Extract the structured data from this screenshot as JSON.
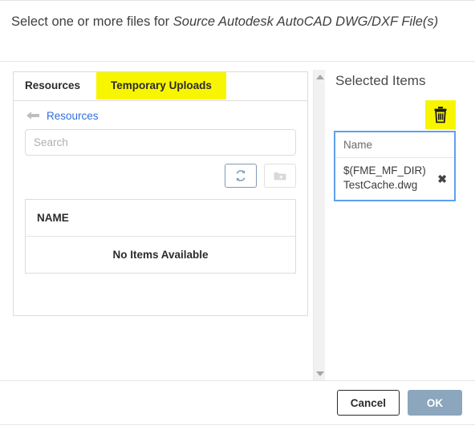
{
  "dialog": {
    "title_plain": "Select one or more files for ",
    "title_emphasis": "Source Autodesk AutoCAD DWG/DXF File(s)"
  },
  "browse_panel": {
    "tabs": [
      {
        "label": "Resources",
        "active": true,
        "highlighted": false
      },
      {
        "label": "Temporary Uploads",
        "active": false,
        "highlighted": true
      }
    ],
    "breadcrumb": {
      "back_icon": "back-arrow-icon",
      "link_label": "Resources"
    },
    "search": {
      "value": "",
      "placeholder": "Search"
    },
    "toolbar": [
      {
        "name": "refresh-button",
        "icon": "refresh-icon",
        "disabled": false
      },
      {
        "name": "new-folder-button",
        "icon": "new-folder-icon",
        "disabled": true
      }
    ],
    "table": {
      "columns": [
        "NAME"
      ],
      "empty_message": "No Items Available",
      "rows": []
    }
  },
  "scrollbar": {
    "up_icon": "scroll-up-arrow-icon",
    "down_icon": "scroll-down-arrow-icon"
  },
  "selected_panel": {
    "title": "Selected Items",
    "delete_icon": "trash-icon",
    "column_header": "Name",
    "items": [
      {
        "name": "$(FME_MF_DIR)TestCache.dwg",
        "remove_icon": "close-icon"
      }
    ]
  },
  "footer": {
    "cancel_label": "Cancel",
    "ok_label": "OK"
  },
  "colors": {
    "highlight": "#f8f500",
    "link": "#2f6fdd",
    "selection_border": "#5fa0ee",
    "ok_button": "#8ba6bd"
  }
}
